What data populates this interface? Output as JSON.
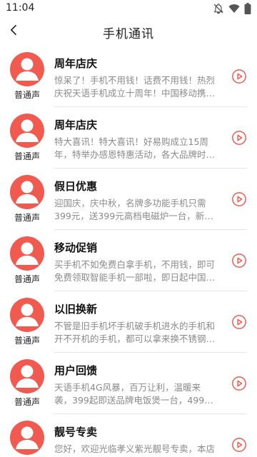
{
  "status_bar": {
    "time": "11:04",
    "icons": [
      "notifications-off-icon",
      "wifi-icon",
      "battery-icon"
    ]
  },
  "header": {
    "title": "手机通讯",
    "back_icon": "chevron-left-icon"
  },
  "colors": {
    "accent": "#f05a4f",
    "title_text": "#111111",
    "desc_text": "#8a8a8a"
  },
  "items": [
    {
      "title": "周年店庆",
      "desc": "惊呆了！手机不用钱！话费不用钱！热烈庆祝天语手机成立十周年！中国移动携手天...",
      "avatar_label": "普通声"
    },
    {
      "title": "周年店庆",
      "desc": "特大喜讯！特大喜讯！好易购成立15周年，特举办感恩特惠活动，各大品牌时尚手机...",
      "avatar_label": "普通声"
    },
    {
      "title": "假日优惠",
      "desc": "迎国庆，庆中秋，名牌多功能手机只需399元，送399元高档电磁炉一台，新款安卓...",
      "avatar_label": "普通声"
    },
    {
      "title": "移动促销",
      "desc": "买手机不如免费白拿手机，不用钱，即可免费领取智能手机一部啦，即日起中国移动...",
      "avatar_label": "普通声"
    },
    {
      "title": "以旧换新",
      "desc": "不管是旧手机坏手机破手机进水的手机和开不开机的手机，都可以拿来换不锈钢脸盆...",
      "avatar_label": "普通声"
    },
    {
      "title": "用户回馈",
      "desc": "天语手机4G风暴，百万让利，温暖来袭，399起即送品牌电饭煲一台，499即送品牌...",
      "avatar_label": "普通声"
    },
    {
      "title": "靓号专卖",
      "desc": "您好，欢迎光临孝义紫光靓号专卖，本店长...",
      "avatar_label": "普通声"
    }
  ]
}
